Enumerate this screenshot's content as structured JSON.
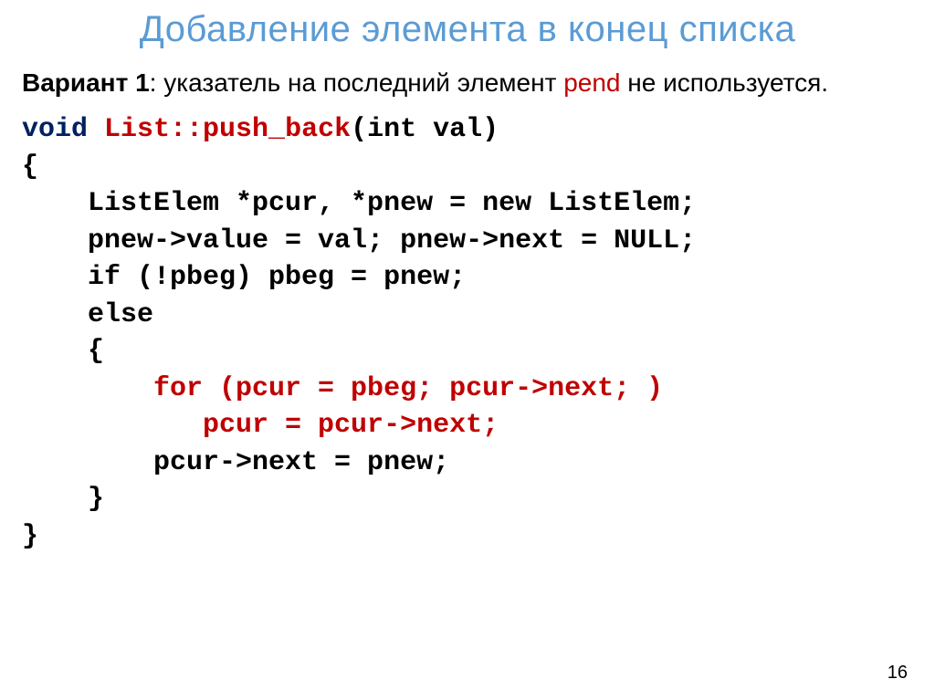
{
  "title": "Добавление элемента в конец списка",
  "subtitle": {
    "variant_label": "Вариант 1",
    "colon": ": ",
    "text_before_pend": "указатель на последний элемент ",
    "pend": "pend",
    "text_after_pend": " не используется."
  },
  "code": {
    "l1a": "void",
    "l1b": " ",
    "l1c": "List::push_back",
    "l1d": "(int val)",
    "l2": "{",
    "l3": "    ListElem *pcur, *pnew = new ListElem;",
    "l4": "    pnew->value = val; pnew->next = NULL;",
    "l5": "    if (!pbeg) pbeg = pnew;",
    "l6": "    else",
    "l7": "    {",
    "l8": "        for (pcur = pbeg; pcur->next; )",
    "l9": "           pcur = pcur->next;",
    "l10": "        pcur->next = pnew;",
    "l11": "    }",
    "l12": "}"
  },
  "page_number": "16"
}
